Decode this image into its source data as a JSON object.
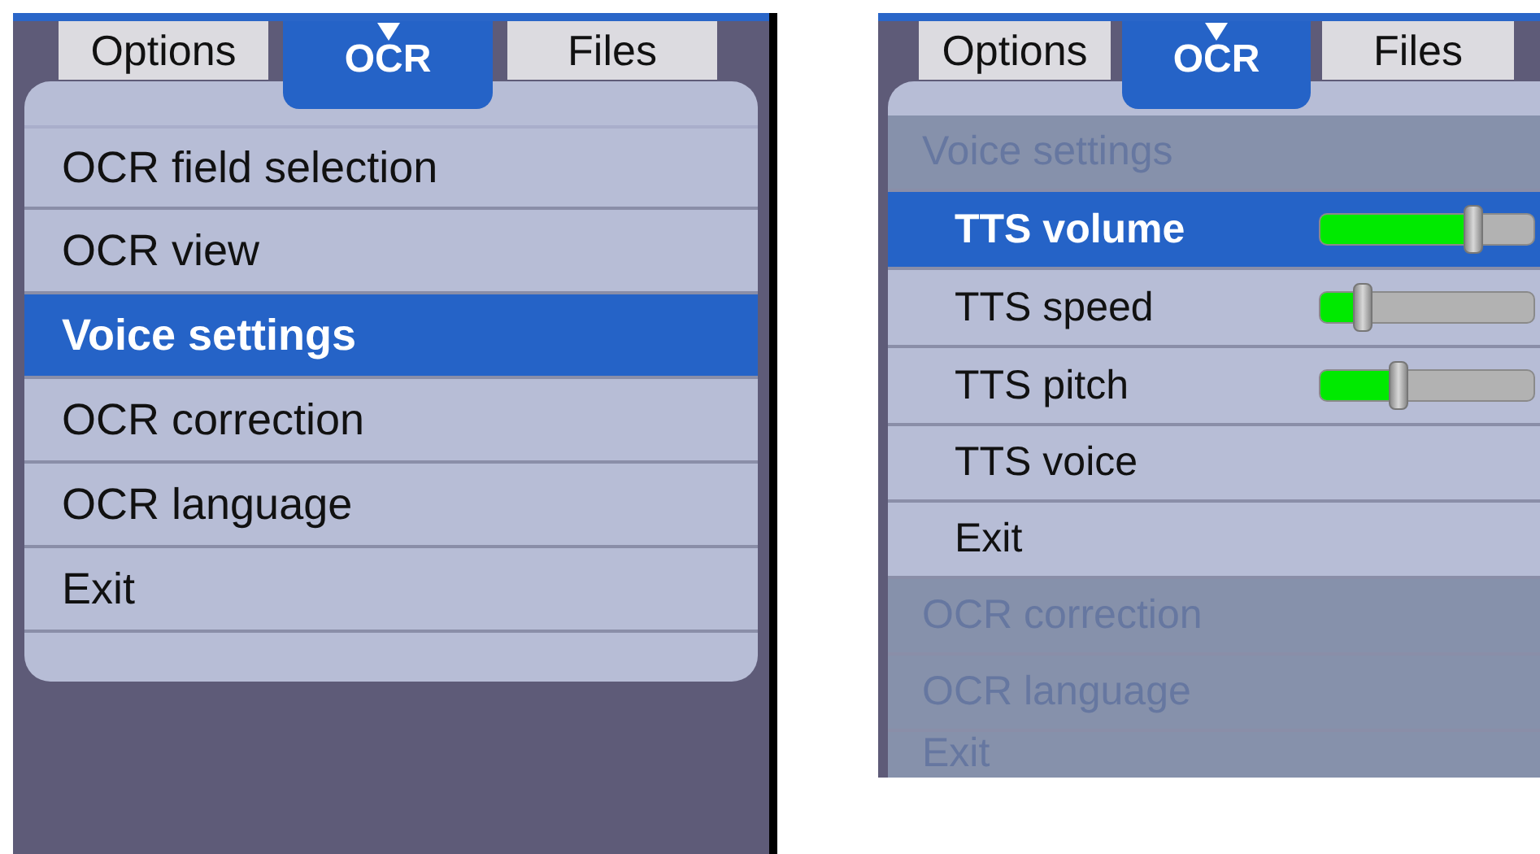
{
  "screens": [
    {
      "tabs": [
        {
          "label": "Options",
          "selected": false
        },
        {
          "label": "OCR",
          "selected": true
        },
        {
          "label": "Files",
          "selected": false
        }
      ],
      "menu": [
        {
          "kind": "item",
          "label": "OCR field selection",
          "selected": false
        },
        {
          "kind": "item",
          "label": "OCR view",
          "selected": false
        },
        {
          "kind": "item",
          "label": "Voice settings",
          "selected": true
        },
        {
          "kind": "item",
          "label": "OCR correction",
          "selected": false
        },
        {
          "kind": "item",
          "label": "OCR language",
          "selected": false
        },
        {
          "kind": "item",
          "label": "Exit",
          "selected": false
        }
      ]
    },
    {
      "tabs": [
        {
          "label": "Options",
          "selected": false
        },
        {
          "label": "OCR",
          "selected": true
        },
        {
          "label": "Files",
          "selected": false
        }
      ],
      "menu": [
        {
          "kind": "header",
          "label": "Voice settings",
          "disabled": true
        },
        {
          "kind": "slider",
          "label": "TTS volume",
          "selected": true,
          "level": 0.72
        },
        {
          "kind": "slider",
          "label": "TTS speed",
          "selected": false,
          "level": 0.2
        },
        {
          "kind": "slider",
          "label": "TTS pitch",
          "selected": false,
          "level": 0.37
        },
        {
          "kind": "subitem",
          "label": "TTS voice",
          "selected": false
        },
        {
          "kind": "subitem",
          "label": "Exit",
          "selected": false
        },
        {
          "kind": "item",
          "label": "OCR correction",
          "disabled": true
        },
        {
          "kind": "item",
          "label": "OCR language",
          "disabled": true
        },
        {
          "kind": "item",
          "label": "Exit",
          "disabled": true
        }
      ]
    }
  ]
}
